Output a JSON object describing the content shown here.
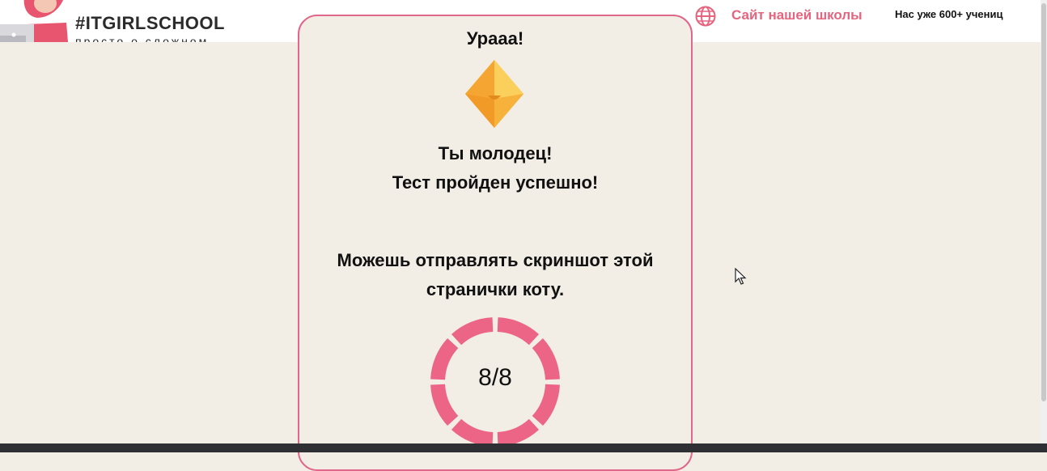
{
  "header": {
    "logo_title": "#ITGIRLSCHOOL",
    "logo_tagline": "просто о сложном",
    "site_link": "Сайт нашей школы",
    "students": "Нас уже 600+ учениц"
  },
  "result": {
    "title": "Урааа!",
    "line1": "Ты молодец!",
    "line2": "Тест пройден успешно!",
    "line3": "Можешь отправлять скриншот этой",
    "line4": "странички коту.",
    "score": "8/8",
    "score_value": 8,
    "score_total": 8
  },
  "colors": {
    "accent": "#e5647e",
    "ring": "#ec6586",
    "background": "#f2eee6"
  }
}
